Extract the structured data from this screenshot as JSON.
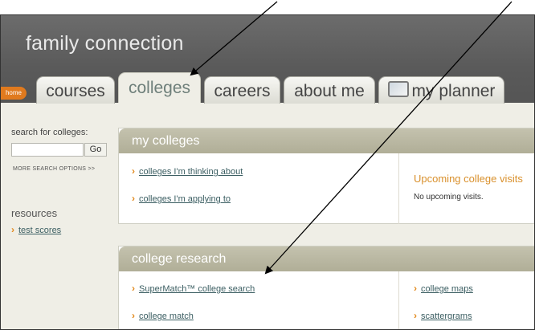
{
  "app": {
    "title": "family connection"
  },
  "home_label": "home",
  "tabs": [
    {
      "label": "courses",
      "active": false
    },
    {
      "label": "colleges",
      "active": true
    },
    {
      "label": "careers",
      "active": false
    },
    {
      "label": "about me",
      "active": false
    },
    {
      "label": "my planner",
      "active": false,
      "icon": "planner-icon"
    }
  ],
  "sidebar": {
    "search_label": "search for colleges:",
    "search_value": "",
    "go_label": "Go",
    "more_options_label": "MORE SEARCH OPTIONS >>",
    "resources_heading": "resources",
    "resources_links": [
      "test scores"
    ]
  },
  "my_colleges": {
    "title": "my colleges",
    "links": [
      "colleges I'm thinking about",
      "colleges I'm applying to"
    ],
    "upcoming_heading": "Upcoming college visits",
    "upcoming_text": "No upcoming visits."
  },
  "college_research": {
    "title": "college research",
    "left_links": [
      "SuperMatch™ college search",
      "college match"
    ],
    "right_links": [
      "college maps",
      "scattergrams"
    ]
  },
  "colors": {
    "accent_orange": "#e28a1e",
    "link": "#3b5e62",
    "header_gray": "#5a5a5a",
    "panel_header": "#b8b6a0"
  }
}
